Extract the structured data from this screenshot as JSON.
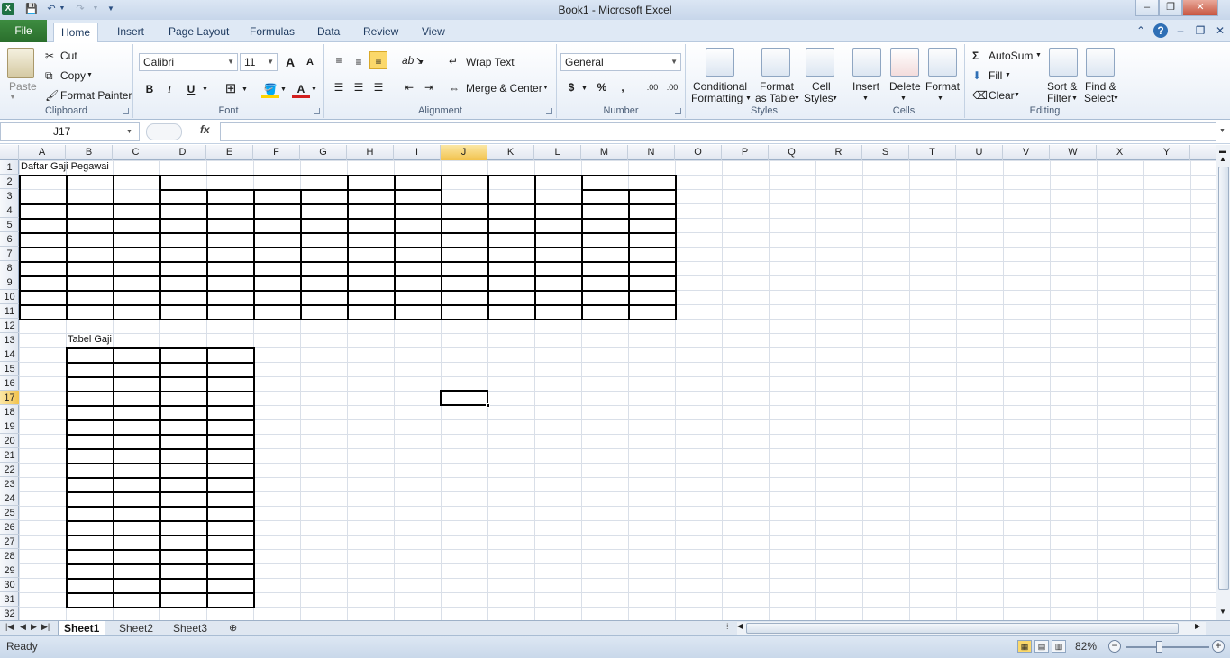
{
  "app": {
    "title": "Book1  -  Microsoft Excel",
    "window_controls": {
      "minimize": "‒",
      "maximize": "❐",
      "close": "✕"
    }
  },
  "quick_access": {
    "save_icon": "save-icon",
    "undo_icon": "undo-icon",
    "redo_icon": "redo-icon"
  },
  "tabs": [
    "File",
    "Home",
    "Insert",
    "Page Layout",
    "Formulas",
    "Data",
    "Review",
    "View"
  ],
  "active_tab": "Home",
  "ribbon": {
    "clipboard": {
      "label": "Clipboard",
      "paste": "Paste",
      "cut": "Cut",
      "copy": "Copy",
      "format_painter": "Format Painter"
    },
    "font": {
      "label": "Font",
      "font_name": "Calibri",
      "font_size": "11",
      "grow": "A",
      "shrink": "A",
      "bold": "B",
      "italic": "I",
      "underline": "U",
      "font_color": "A"
    },
    "alignment": {
      "label": "Alignment",
      "wrap_text": "Wrap Text",
      "merge_center": "Merge & Center"
    },
    "number": {
      "label": "Number",
      "format": "General",
      "currency": "$",
      "percent": "%",
      "comma": ",",
      "inc_decimal": ".00",
      "dec_decimal": ".00"
    },
    "styles": {
      "label": "Styles",
      "conditional_1": "Conditional",
      "conditional_2": "Formatting",
      "format_table_1": "Format",
      "format_table_2": "as Table",
      "cell_styles_1": "Cell",
      "cell_styles_2": "Styles"
    },
    "cells": {
      "label": "Cells",
      "insert": "Insert",
      "delete": "Delete",
      "format": "Format"
    },
    "editing": {
      "label": "Editing",
      "autosum": "AutoSum",
      "fill": "Fill",
      "clear": "Clear",
      "sort_1": "Sort &",
      "sort_2": "Filter",
      "find_1": "Find &",
      "find_2": "Select"
    }
  },
  "formula_bar": {
    "name_box": "J17",
    "fx": "fx",
    "formula": ""
  },
  "columns": [
    "A",
    "B",
    "C",
    "D",
    "E",
    "F",
    "G",
    "H",
    "I",
    "J",
    "K",
    "L",
    "M",
    "N",
    "O",
    "P",
    "Q",
    "R",
    "S",
    "T",
    "U",
    "V",
    "W",
    "X",
    "Y"
  ],
  "rows": [
    "1",
    "2",
    "3",
    "4",
    "5",
    "6",
    "7",
    "8",
    "9",
    "10",
    "11",
    "12",
    "13",
    "14",
    "15",
    "16",
    "17",
    "18",
    "19",
    "20",
    "21",
    "22",
    "23",
    "24",
    "25",
    "26",
    "27",
    "28",
    "29",
    "30",
    "31",
    "32"
  ],
  "selected_cell": {
    "col": "J",
    "row": "17"
  },
  "cells": {
    "A1": "Daftar Gaji Pegawai",
    "B13": "Tabel Gaji"
  },
  "sheets": [
    "Sheet1",
    "Sheet2",
    "Sheet3"
  ],
  "active_sheet": "Sheet1",
  "status": {
    "text": "Ready",
    "zoom": "82%"
  },
  "colors": {
    "file_tab": "#2a6e2c",
    "selected_header": "#f2c34e",
    "gridline": "#d9dfe8"
  }
}
